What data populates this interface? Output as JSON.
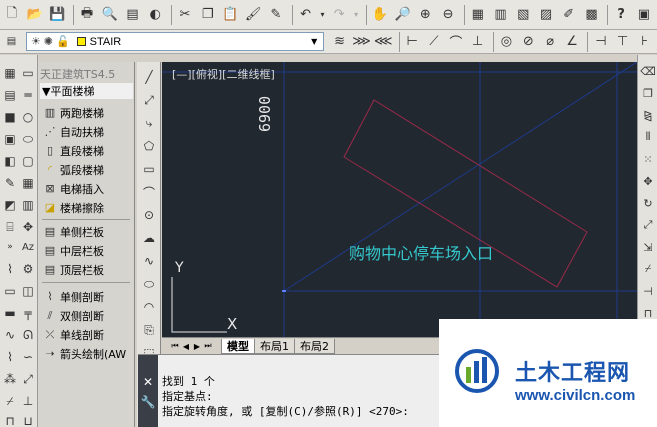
{
  "toolbar1": {
    "icons": [
      "new-file-icon",
      "open-icon",
      "save-icon",
      "print-icon",
      "preview-icon",
      "publish-icon",
      "3d-icon",
      "cut-icon",
      "copy-icon",
      "paste-icon",
      "match-icon",
      "block-edit-icon",
      "undo-icon",
      "redo-icon",
      "pan-icon",
      "zoom-realtime-icon",
      "zoom-window-icon",
      "zoom-previous-icon",
      "properties-icon",
      "design-center-icon",
      "tool-palette-icon",
      "sheetset-icon",
      "markup-icon",
      "calculator-icon",
      "help-icon"
    ]
  },
  "toolbar2": {
    "layer_name": "STAIR"
  },
  "tangent_menu": {
    "title": "天正建筑TS4.5",
    "header": "▼平面楼梯",
    "items": [
      {
        "label": "两跑楼梯"
      },
      {
        "label": "自动扶梯"
      },
      {
        "label": "直段楼梯"
      },
      {
        "label": "弧段楼梯"
      },
      {
        "label": "电梯插入"
      },
      {
        "label": "楼梯擦除"
      },
      {
        "label": "单侧栏板"
      },
      {
        "label": "中层栏板"
      },
      {
        "label": "顶层栏板"
      },
      {
        "label": "单侧剖断"
      },
      {
        "label": "双侧剖断"
      },
      {
        "label": "单线剖断"
      },
      {
        "label": "箭头绘制(AW"
      }
    ]
  },
  "canvas": {
    "viewport_label": "[—][俯视][二维线框]",
    "dimension_text": "6900",
    "annotation": "购物中心停车场入口",
    "ucs_x": "X",
    "ucs_y": "Y"
  },
  "layout_tabs": {
    "tabs": [
      "模型",
      "布局1",
      "布局2"
    ],
    "active": "模型"
  },
  "command_line": {
    "lines": [
      "找到 1 个",
      "指定基点:",
      "指定旋转角度, 或 [复制(C)/参照(R)] <270>:"
    ]
  },
  "watermark": {
    "title": "土木工程网",
    "url": "www.civilcn.com"
  },
  "colors": {
    "canvas_bg": "#212830",
    "annotation_text": "#35c8cc",
    "rect_outline": "#9a2a4a",
    "grid_line": "#1e3a8a",
    "watermark_blue": "#1a55b0"
  }
}
